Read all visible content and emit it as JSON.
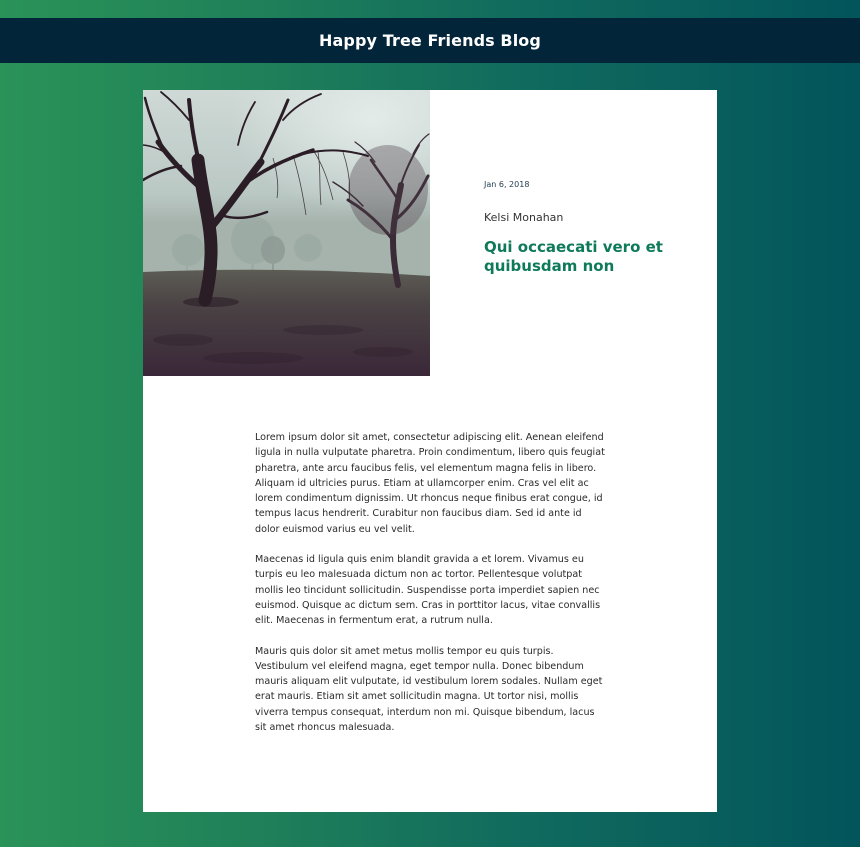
{
  "site": {
    "title": "Happy Tree Friends Blog"
  },
  "post": {
    "image": {
      "alt": "foggy park with bare trees"
    },
    "date": "Jan 6, 2018",
    "author": "Kelsi Monahan",
    "title": "Qui occaecati vero et quibusdam non",
    "paragraphs": [
      "Lorem ipsum dolor sit amet, consectetur adipiscing elit. Aenean eleifend ligula in nulla vulputate pharetra. Proin condimentum, libero quis feugiat pharetra, ante arcu faucibus felis, vel elementum magna felis in libero. Aliquam id ultricies purus. Etiam at ullamcorper enim. Cras vel elit ac lorem condimentum dignissim. Ut rhoncus neque finibus erat congue, id tempus lacus hendrerit. Curabitur non faucibus diam. Sed id ante id dolor euismod varius eu vel velit.",
      "Maecenas id ligula quis enim blandit gravida a et lorem. Vivamus eu turpis eu leo malesuada dictum non ac tortor. Pellentesque volutpat mollis leo tincidunt sollicitudin. Suspendisse porta imperdiet sapien nec euismod. Quisque ac dictum sem. Cras in porttitor lacus, vitae convallis elit. Maecenas in fermentum erat, a rutrum nulla.",
      "Mauris quis dolor sit amet metus mollis tempor eu quis turpis. Vestibulum vel eleifend magna, eget tempor nulla. Donec bibendum mauris aliquam elit vulputate, id vestibulum lorem sodales. Nullam eget erat mauris. Etiam sit amet sollicitudin magna. Ut tortor nisi, mollis viverra tempus consequat, interdum non mi. Quisque bibendum, lacus sit amet rhoncus malesuada."
    ]
  },
  "colors": {
    "header_bg": "#03253a",
    "accent_title": "#0f7a5a",
    "gradient_left": "#2a9358",
    "gradient_right": "#02555b"
  }
}
